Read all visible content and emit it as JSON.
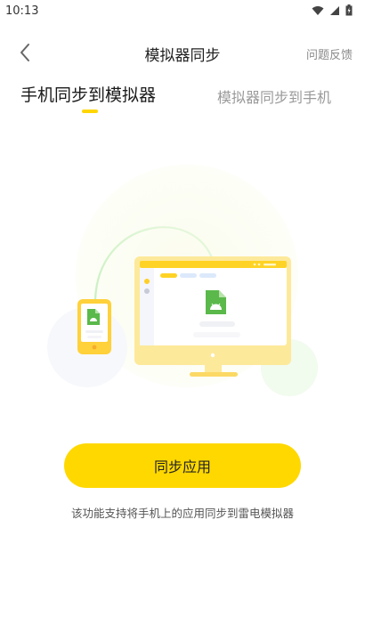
{
  "status_bar": {
    "time": "10:13"
  },
  "header": {
    "title": "模拟器同步",
    "feedback_label": "问题反馈"
  },
  "tabs": [
    {
      "label": "手机同步到模拟器",
      "active": true
    },
    {
      "label": "模拟器同步到手机",
      "active": false
    }
  ],
  "main": {
    "sync_button_label": "同步应用",
    "description": "该功能支持将手机上的应用同步到雷电模拟器"
  },
  "colors": {
    "accent": "#ffd800",
    "android_green": "#5ab94a",
    "text_secondary": "#8a8a8a"
  }
}
